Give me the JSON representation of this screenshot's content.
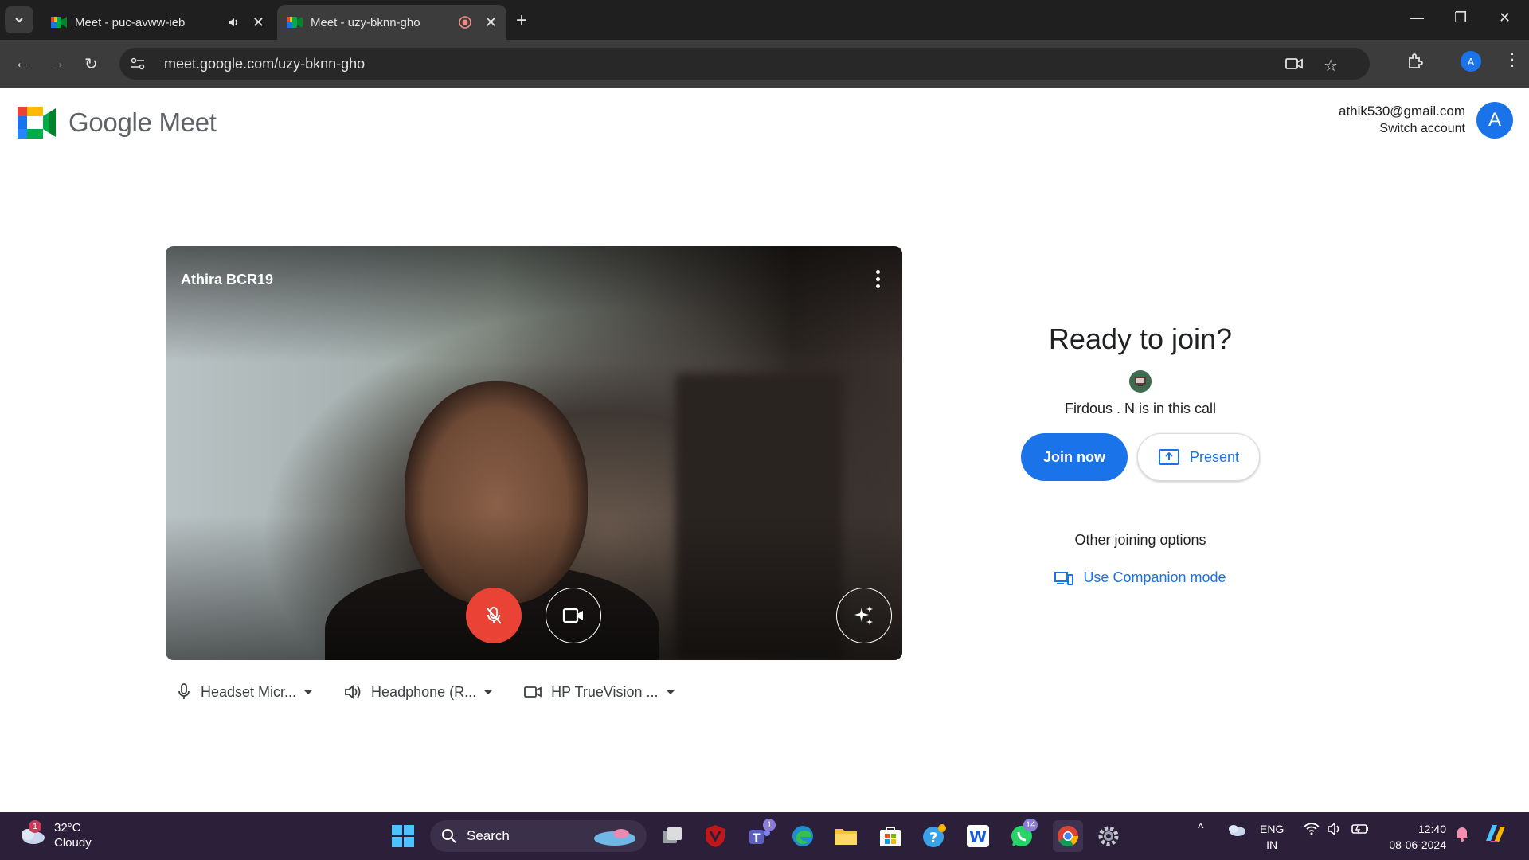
{
  "browser": {
    "tabs": [
      {
        "title": "Meet - puc-avww-ieb",
        "active": false
      },
      {
        "title": "Meet - uzy-bknn-gho",
        "active": true
      }
    ],
    "url": "meet.google.com/uzy-bknn-gho",
    "profile_initial": "A"
  },
  "header": {
    "brand": "Google Meet",
    "account_email": "athik530@gmail.com",
    "switch_account": "Switch account",
    "avatar_initial": "A"
  },
  "preview": {
    "self_name": "Athira BCR19",
    "mic_muted": true,
    "camera_on": true
  },
  "devices": {
    "microphone": "Headset Micr...",
    "speaker": "Headphone (R...",
    "camera": "HP TrueVision ..."
  },
  "join": {
    "heading": "Ready to join?",
    "in_call": "Firdous . N is in this call",
    "join_label": "Join now",
    "present_label": "Present",
    "other_options": "Other joining options",
    "companion_label": "Use Companion mode"
  },
  "taskbar": {
    "weather_temp": "32°C",
    "weather_desc": "Cloudy",
    "weather_badge": "1",
    "search_label": "Search",
    "teams_badge": "1",
    "whatsapp_badge": "14",
    "lang_top": "ENG",
    "lang_bottom": "IN",
    "time": "12:40",
    "date": "08-06-2024"
  },
  "colors": {
    "accent": "#1a73e8",
    "mic_muted": "#ea4335",
    "taskbar": "#2b1f3a"
  }
}
